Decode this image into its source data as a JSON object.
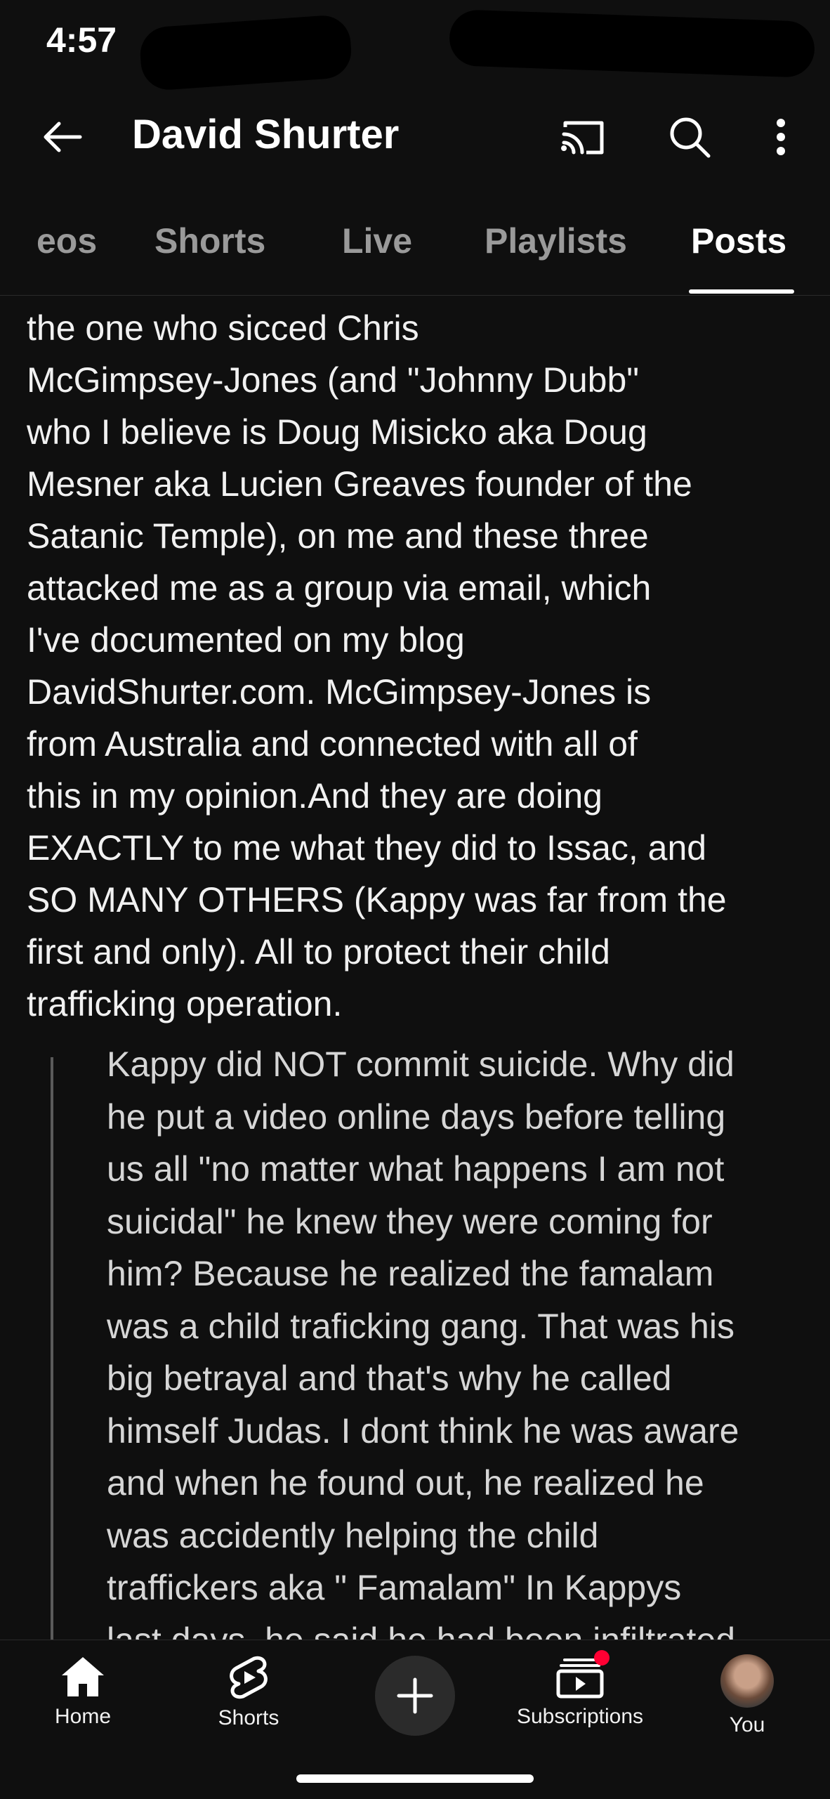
{
  "status_bar": {
    "time": "4:57"
  },
  "header": {
    "channel_title": "David Shurter",
    "icons": [
      "back-arrow-icon",
      "cast-icon",
      "search-icon",
      "more-vert-icon"
    ]
  },
  "tabs": [
    {
      "label": "eos",
      "active": false
    },
    {
      "label": "Shorts",
      "active": false
    },
    {
      "label": "Live",
      "active": false
    },
    {
      "label": "Playlists",
      "active": false
    },
    {
      "label": "Posts",
      "active": true
    }
  ],
  "post": {
    "lines": [
      "the one who sicced Chris",
      "McGimpsey-Jones (and \"Johnny Dubb\"",
      "who I believe is Doug Misicko aka Doug",
      "Mesner aka Lucien Greaves founder of the",
      "Satanic Temple), on me and these three",
      "attacked me as a group via email, which",
      "I've documented on my blog",
      "DavidShurter.com. McGimpsey-Jones is",
      "from Australia and connected with all of",
      "this in my opinion.And they are doing",
      "EXACTLY to me what they did to Issac, and",
      "SO MANY OTHERS (Kappy was far from the",
      "first and only). All to protect their child",
      "trafficking operation."
    ]
  },
  "quote": {
    "lines": [
      "Kappy did NOT commit suicide. Why did",
      "he put a video online days before telling",
      "us all \"no matter what happens I am not",
      "suicidal\" he knew they were coming for",
      "him? Because he realized the famalam",
      "was a child traficking gang. That was his",
      "big betrayal and that's why he called",
      "himself Judas. I dont think he was aware",
      "and when he found out, he realized he",
      "was accidently helping the child",
      "traffickers aka \" Famalam\"  In Kappys",
      "last days, he said he had been infiltrated"
    ]
  },
  "bottom_nav": {
    "items": [
      {
        "label": "Home",
        "icon": "home-icon"
      },
      {
        "label": "Shorts",
        "icon": "shorts-icon"
      },
      {
        "label": "",
        "icon": "create-plus-icon"
      },
      {
        "label": "Subscriptions",
        "icon": "subscriptions-icon"
      },
      {
        "label": "You",
        "icon": "avatar"
      }
    ],
    "badge_color": "#ff0033"
  },
  "colors": {
    "background": "#0f0f0f",
    "text": "#f1f1f1",
    "muted_tab": "#9a9a9a"
  }
}
